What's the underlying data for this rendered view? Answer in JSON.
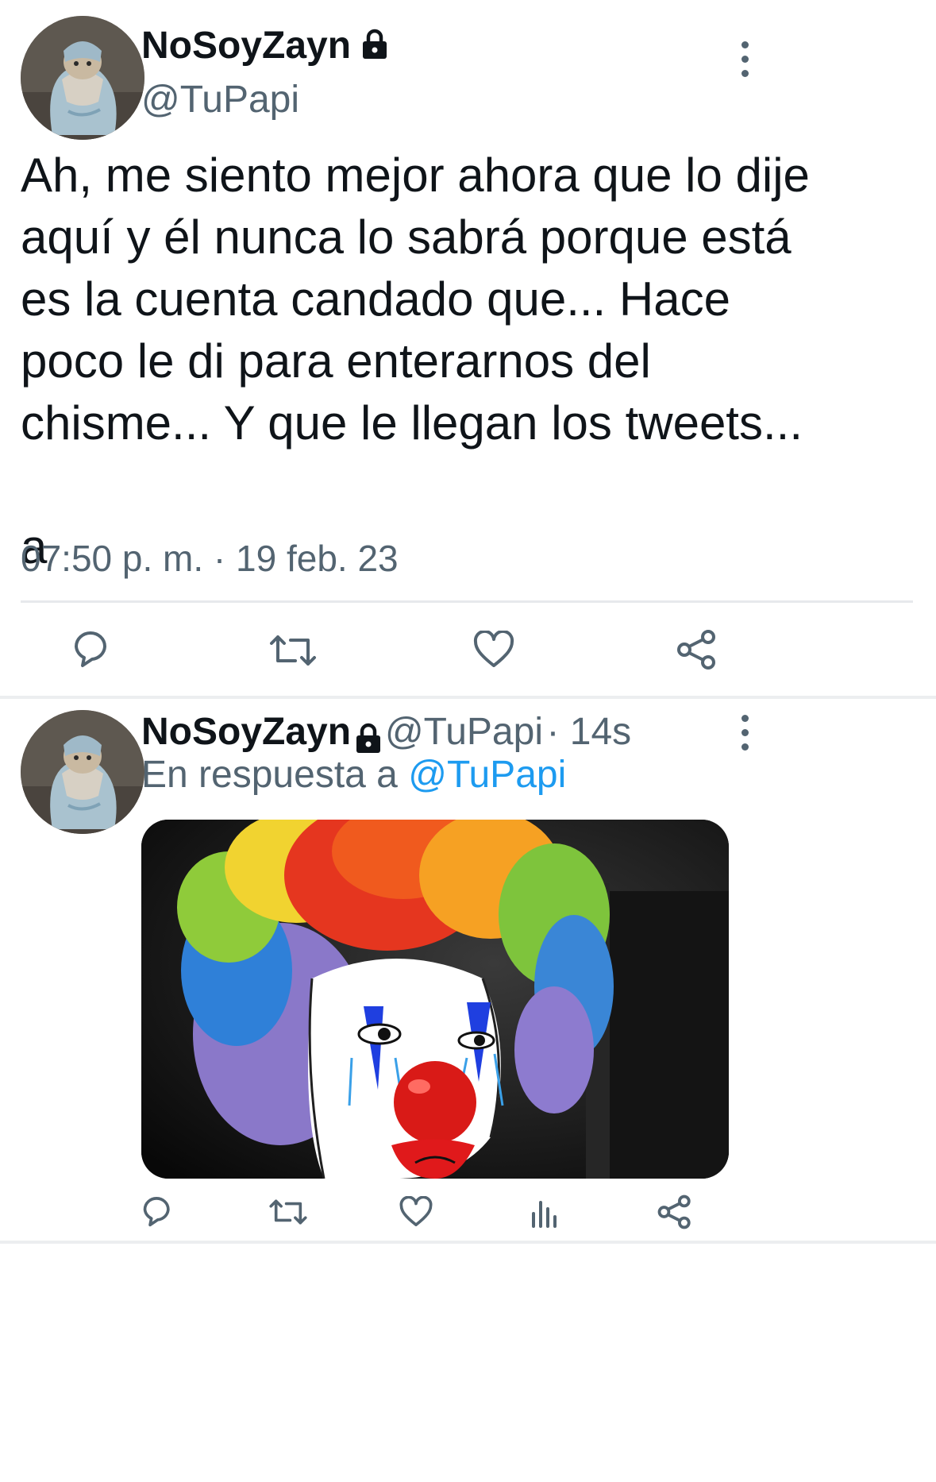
{
  "tweet": {
    "author_name": "NoSoyZayn",
    "author_handle": "@TuPapi",
    "text_lines": [
      "Ah, me siento mejor ahora que lo dije",
      "aquí y él nunca lo sabrá porque está",
      "es la cuenta candado que... Hace",
      "poco le di para enterarnos del",
      "chisme... Y que le llegan los tweets..."
    ],
    "text_tail": "a",
    "timestamp": "07:50 p. m. · 19 feb. 23",
    "icons": [
      "reply-icon",
      "retweet-icon",
      "like-icon",
      "share-icon"
    ]
  },
  "reply": {
    "author_name": "NoSoyZayn",
    "author_handle": "@TuPapi",
    "time": "· 14s",
    "replying_prefix": "En respuesta a",
    "replying_to": "@TuPapi",
    "media_alt": "clown-wig-meme",
    "icons": [
      "reply-icon",
      "retweet-icon",
      "like-icon",
      "analytics-icon",
      "share-icon"
    ]
  },
  "colors": {
    "text": "#0f1419",
    "secondary": "#536471",
    "link": "#1d9bf0",
    "divider": "#e7e9ec"
  }
}
